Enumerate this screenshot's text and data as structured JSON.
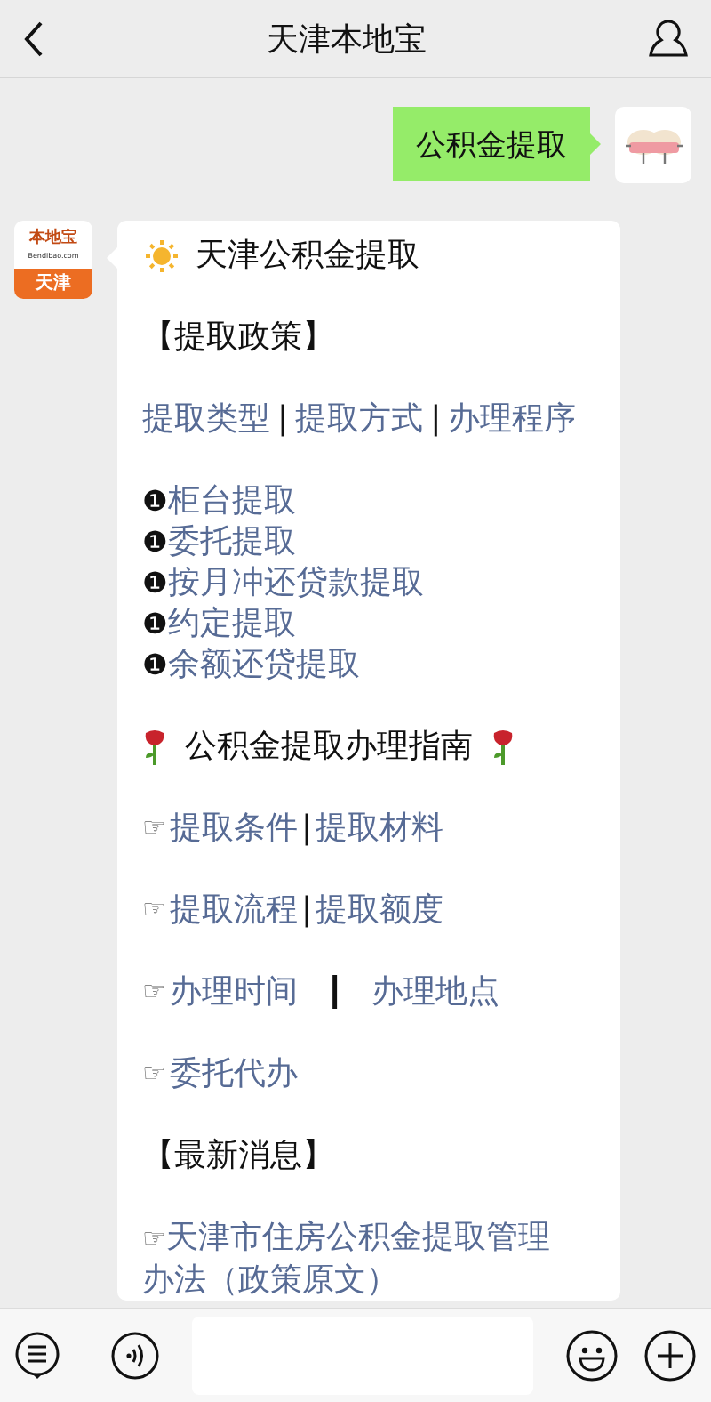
{
  "header": {
    "title": "天津本地宝"
  },
  "user_message": {
    "text": "公积金提取"
  },
  "bot": {
    "logo_top": "本地宝",
    "logo_url": "Bendibao.com",
    "logo_city": "天津",
    "blocks": [
      {
        "kind": "title",
        "text": "天津公积金提取"
      },
      {
        "kind": "section",
        "text": "【提取政策】"
      },
      {
        "kind": "links",
        "items": [
          {
            "kind": "link",
            "text": "提取类型"
          },
          {
            "kind": "sep",
            "text": "|"
          },
          {
            "kind": "link",
            "text": "提取方式"
          },
          {
            "kind": "sep",
            "text": "|"
          },
          {
            "kind": "link",
            "text": "办理程序"
          }
        ]
      },
      {
        "kind": "numbered",
        "items": [
          {
            "marker": "❶",
            "text": "柜台提取"
          },
          {
            "marker": "❶",
            "text": "委托提取"
          },
          {
            "marker": "❶",
            "text": "按月冲还贷款提取"
          },
          {
            "marker": "❶",
            "text": "约定提取"
          },
          {
            "marker": "❶",
            "text": "余额还贷提取"
          }
        ]
      },
      {
        "kind": "guide",
        "text": "公积金提取办理指南"
      },
      {
        "kind": "pointer",
        "marker": "☞",
        "items": [
          {
            "kind": "link",
            "text": "提取条件"
          },
          {
            "kind": "sep",
            "text": "|"
          },
          {
            "kind": "link",
            "text": "提取材料"
          }
        ]
      },
      {
        "kind": "pointer",
        "marker": "☞",
        "items": [
          {
            "kind": "link",
            "text": "提取流程"
          },
          {
            "kind": "sep",
            "text": "|"
          },
          {
            "kind": "link",
            "text": "提取额度"
          }
        ]
      },
      {
        "kind": "pointer",
        "marker": "☞",
        "items": [
          {
            "kind": "link",
            "text": "办理时间"
          },
          {
            "kind": "bar",
            "text": "┃"
          },
          {
            "kind": "link",
            "text": "办理地点"
          }
        ]
      },
      {
        "kind": "pointer",
        "marker": "☞",
        "items": [
          {
            "kind": "link",
            "text": "委托代办"
          }
        ]
      },
      {
        "kind": "section",
        "text": "【最新消息】"
      },
      {
        "kind": "news",
        "items": [
          {
            "marker": "☞",
            "text": "天津市住房公积金提取管理办法（政策原文）"
          }
        ]
      }
    ]
  }
}
